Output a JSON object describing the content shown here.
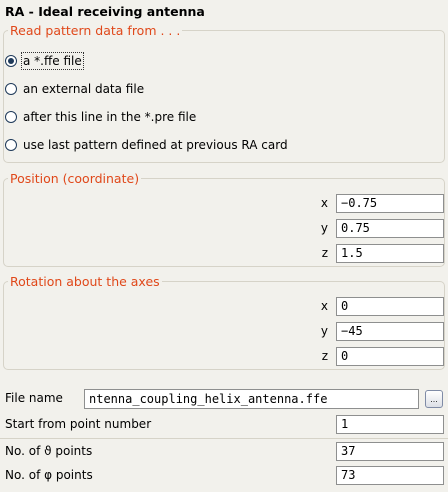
{
  "title": "RA - Ideal receiving antenna",
  "pattern_source": {
    "legend": "Read pattern data from . . .",
    "options": [
      {
        "label": "a *.ffe file",
        "checked": true
      },
      {
        "label": "an external data file",
        "checked": false
      },
      {
        "label": "after this line in the *.pre file",
        "checked": false
      },
      {
        "label": "use last pattern defined at previous RA card",
        "checked": false
      }
    ]
  },
  "position": {
    "legend": "Position (coordinate)",
    "x_label": "x",
    "x": "−0.75",
    "y_label": "y",
    "y": "0.75",
    "z_label": "z",
    "z": "1.5"
  },
  "rotation": {
    "legend": "Rotation about the axes",
    "x_label": "x",
    "x": "0",
    "y_label": "y",
    "y": "−45",
    "z_label": "z",
    "z": "0"
  },
  "file": {
    "label": "File name",
    "value": "ntenna_coupling_helix_antenna.ffe",
    "browse_label": "..."
  },
  "start_point": {
    "label": "Start from point number",
    "value": "1"
  },
  "theta_points": {
    "label": "No. of ϑ points",
    "value": "37"
  },
  "phi_points": {
    "label": "No. of φ points",
    "value": "73"
  }
}
